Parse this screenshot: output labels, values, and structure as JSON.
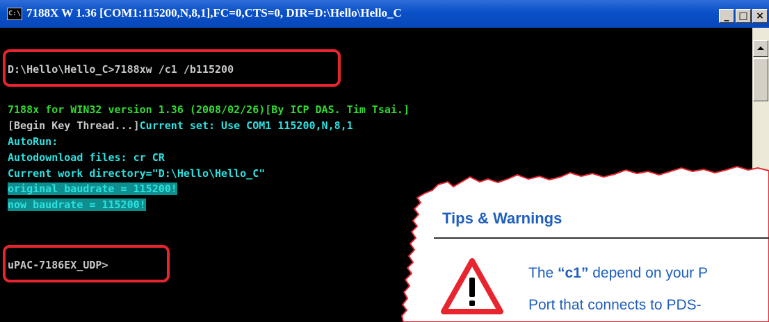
{
  "window": {
    "title_icon": "C:\\",
    "title": "7188X W 1.36 [COM1:115200,N,8,1],FC=0,CTS=0, DIR=D:\\Hello\\Hello_C",
    "minimize_label": "_",
    "maximize_label": "□",
    "close_label": "×"
  },
  "console": {
    "lines": [
      "D:\\Hello\\Hello_C>7188xw /c1 /b115200",
      "7188x for WIN32 version 1.36 (2008/02/26)[By ICP DAS. Tim Tsai.]",
      "[Begin Key Thread...]",
      "Current set: Use COM1 115200,N,8,1",
      "AutoRun:",
      "Autodownload files: cr CR",
      "Current work directory=\"D:\\Hello\\Hello_C\"",
      "original baudrate = 115200!",
      "now baudrate = 115200!",
      "uPAC-7186EX_UDP>"
    ]
  },
  "tips": {
    "heading": "Tips & Warnings",
    "warning_line1_prefix": "The ",
    "warning_line1_bold": "“c1”",
    "warning_line1_suffix": " depend on your P",
    "warning_line2": "Port that connects to PDS-"
  },
  "colors": {
    "titlebar": "#0a50c8",
    "console_bg": "#000000",
    "text_green": "#2fdc2f",
    "text_cyan": "#2ee0e0",
    "highlight": "#0e8f8f",
    "annotation_red": "#e8252e",
    "tips_blue": "#1f5fbd"
  },
  "icons": [
    "console-app-icon",
    "minimize-icon",
    "maximize-icon",
    "close-icon",
    "scroll-up-icon",
    "warning-triangle-icon"
  ]
}
